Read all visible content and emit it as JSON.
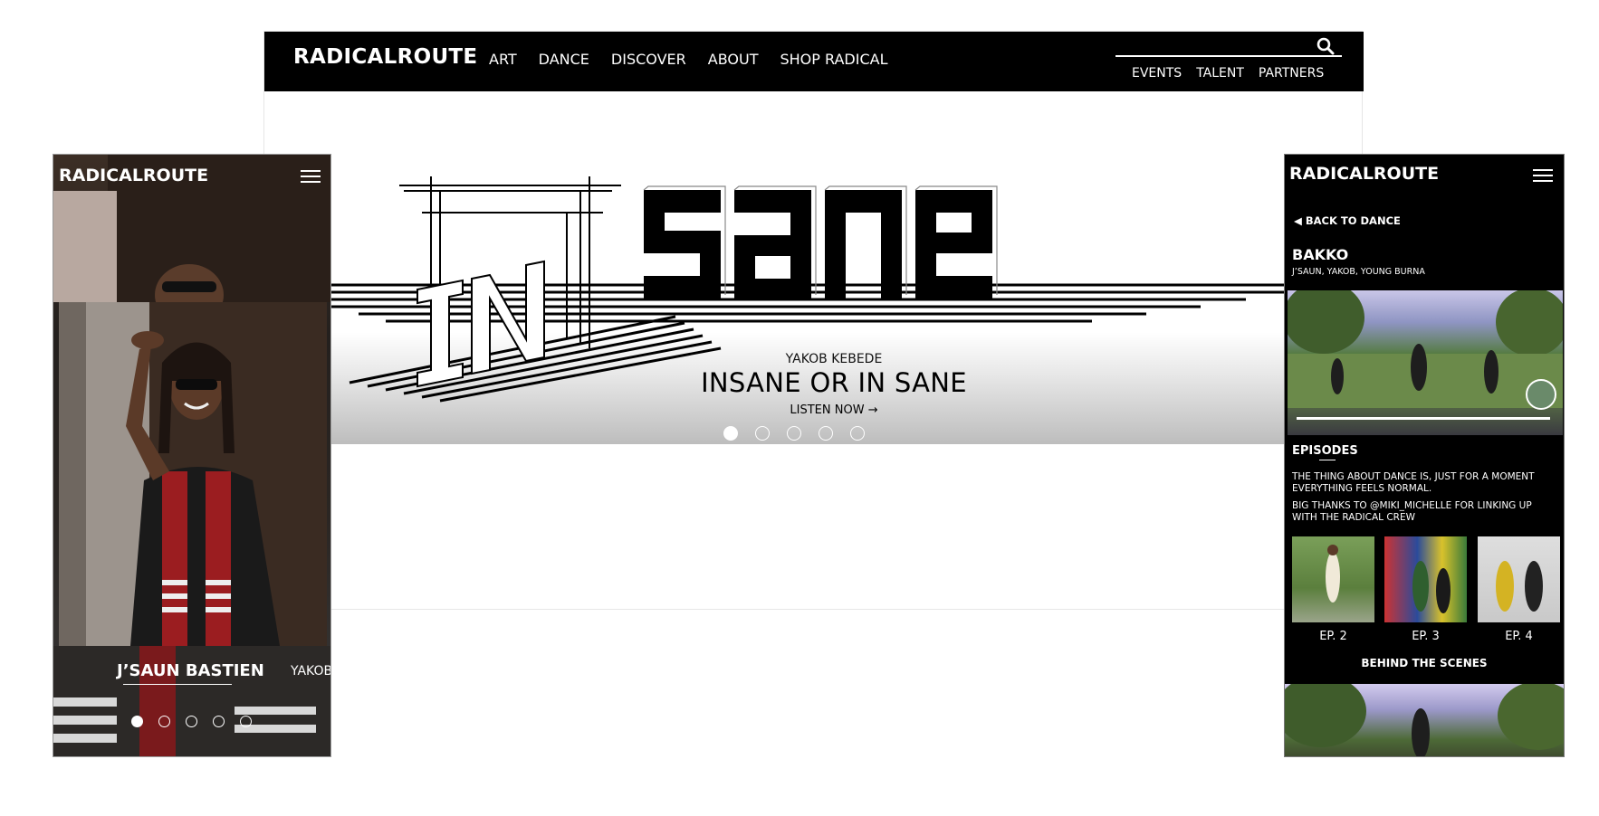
{
  "desktop": {
    "logo": "RADICALROUTE",
    "menu": [
      "ART",
      "DANCE",
      "DISCOVER",
      "ABOUT",
      "SHOP RADICAL"
    ],
    "secondary_menu": [
      "EVENTS",
      "TALENT",
      "PARTNERS"
    ],
    "hero": {
      "art_word_small": "IN",
      "art_word_large": "sane",
      "subtitle": "YAKOB KEBEDE",
      "title": "INSANE OR IN SANE",
      "cta": "LISTEN NOW →",
      "active_slide": 1,
      "slide_count": 5
    }
  },
  "phone_left": {
    "logo": "RADICALROUTE",
    "current_name": "J’SAUN BASTIEN",
    "next_name": "YAKOB",
    "active_slide": 1,
    "slide_count": 5
  },
  "phone_right": {
    "logo": "RADICALROUTE",
    "back_link": "◀ BACK TO DANCE",
    "title": "BAKKO",
    "credits": "J’SAUN, YAKOB, YOUNG BURNA",
    "episodes_heading": "EPISODES",
    "description": "THE THING ABOUT DANCE IS, JUST FOR A MOMENT EVERYTHING FEELS NORMAL.",
    "thanks": "BIG THANKS TO @MIKI_MICHELLE FOR LINKING UP WITH THE RADICAL CREW",
    "episodes": [
      {
        "label": "EP. 2"
      },
      {
        "label": "EP. 3"
      },
      {
        "label": "EP. 4"
      }
    ],
    "behind_heading": "BEHIND THE SCENES"
  },
  "colors": {
    "nav_bg": "#000000",
    "text_light": "#ffffff",
    "text_dark": "#000000"
  }
}
